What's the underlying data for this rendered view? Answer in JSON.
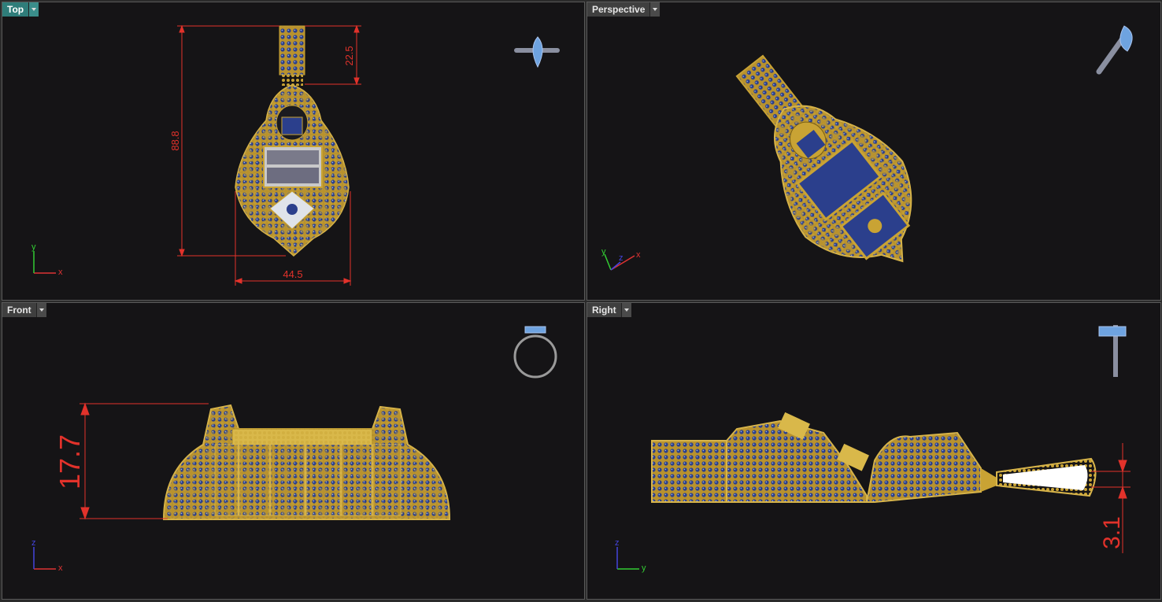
{
  "viewports": {
    "top": {
      "title": "Top"
    },
    "perspective": {
      "title": "Perspective"
    },
    "front": {
      "title": "Front"
    },
    "right": {
      "title": "Right"
    }
  },
  "dimensions": {
    "top_length": "88.8",
    "top_bail": "22.5",
    "top_width": "44.5",
    "front_height": "17.7",
    "right_thickness": "3.1"
  },
  "axes": {
    "top": {
      "h": "x",
      "v": "y"
    },
    "persp": {
      "h": "x",
      "v": "y",
      "d": "z"
    },
    "front": {
      "h": "x",
      "v": "z"
    },
    "right": {
      "h": "y",
      "v": "z"
    }
  },
  "colors": {
    "gold": "#c9a334",
    "gold_dark": "#7a5f14",
    "stone_blue": "#2b3f8c",
    "stone_light": "#7f9fd8",
    "dim_red": "#e2322b",
    "axis_x": "#d33",
    "axis_y": "#3c3",
    "axis_z": "#44d",
    "active_tab": "#2f7d7a"
  }
}
